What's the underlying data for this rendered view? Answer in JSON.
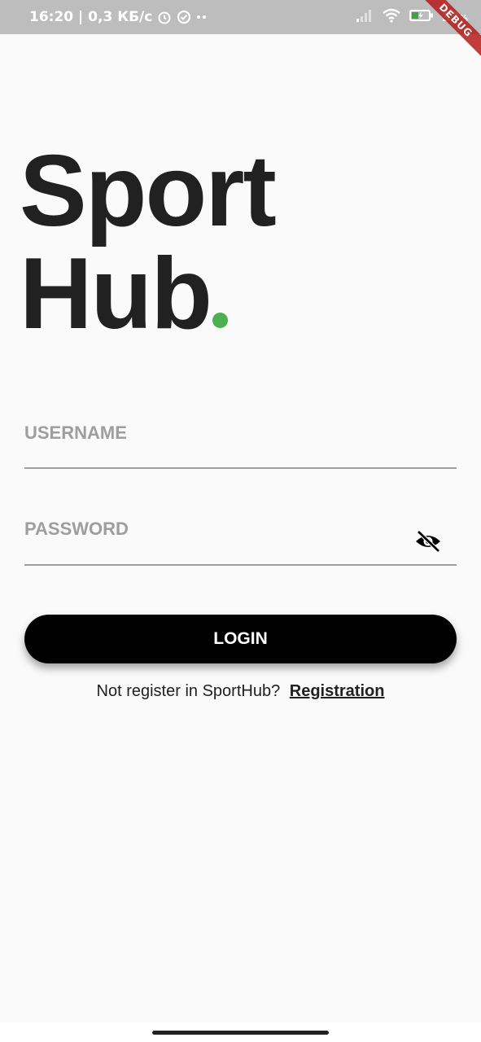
{
  "status_bar": {
    "time_info": "16:20 | 0,3 КБ/с",
    "battery": "37",
    "battery_unit": "%",
    "icons": [
      "alarm-icon",
      "vpn-icon",
      "more-dots-icon",
      "signal-icon",
      "wifi-icon",
      "battery-charging-icon"
    ]
  },
  "debug_banner": "DEBUG",
  "logo": {
    "line1": "Sport",
    "line2": "Hub",
    "dot_color": "#4caf50"
  },
  "form": {
    "username_placeholder": "USERNAME",
    "password_placeholder": "PASSWORD",
    "password_toggle_icon": "visibility-off-icon"
  },
  "login_button": "LOGIN",
  "register": {
    "prompt": "Not register in SportHub?",
    "link": "Registration"
  },
  "colors": {
    "background": "#fafafa",
    "accent": "#4caf50",
    "button": "#000000",
    "placeholder": "#9e9e9e"
  }
}
